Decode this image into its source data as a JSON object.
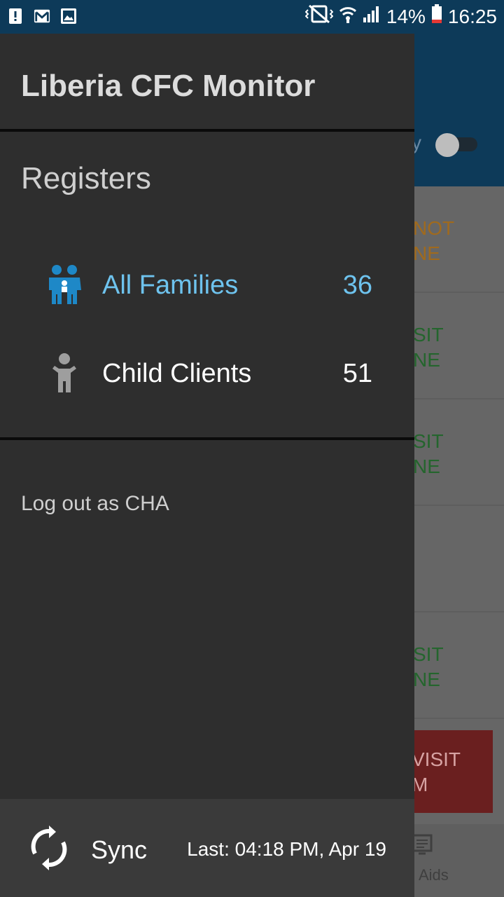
{
  "status_bar": {
    "battery_percent": "14%",
    "time": "16:25"
  },
  "background": {
    "toggle_label_partial": "y",
    "rows": [
      {
        "line1": "NOT",
        "line2": "NE",
        "color": "orange"
      },
      {
        "line1": "SIT",
        "line2": "NE",
        "color": "green"
      },
      {
        "line1": "SIT",
        "line2": "NE",
        "color": "green"
      },
      {
        "line1": "",
        "line2": "",
        "color": "none"
      },
      {
        "line1": "SIT",
        "line2": "NE",
        "color": "green"
      }
    ],
    "red_button": {
      "line1": "VISIT",
      "line2": "M"
    },
    "bottom_tab_label": "Aids"
  },
  "drawer": {
    "title": "Liberia CFC Monitor",
    "section": "Registers",
    "items": [
      {
        "label": "All Families",
        "count": "36",
        "icon": "family-icon",
        "active": true
      },
      {
        "label": "Child Clients",
        "count": "51",
        "icon": "child-icon",
        "active": false
      }
    ],
    "logout_label": "Log out as CHA",
    "sync": {
      "label": "Sync",
      "last": "Last: 04:18 PM, Apr 19"
    }
  },
  "colors": {
    "status_bar": "#0d3a59",
    "drawer_bg": "#2e2e2e",
    "active_accent": "#6ec3ee",
    "icon_blue": "#1e88c7"
  }
}
